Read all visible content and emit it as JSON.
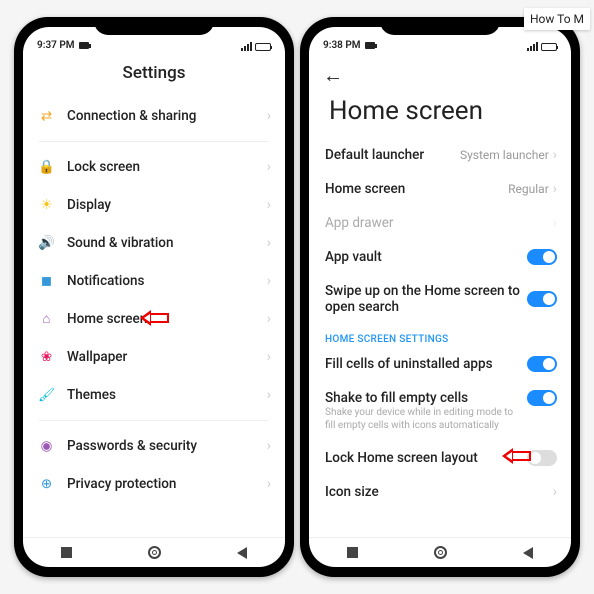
{
  "floating_label": "How To M",
  "left": {
    "status": {
      "time": "9:37 PM",
      "battery_pct": "70"
    },
    "title": "Settings",
    "groups": [
      [
        {
          "icon": "share-icon",
          "color": "ic-orange",
          "label": "Connection & sharing"
        }
      ],
      [
        {
          "icon": "lock-icon",
          "color": "ic-red",
          "label": "Lock screen"
        },
        {
          "icon": "sun-icon",
          "color": "ic-yellow",
          "label": "Display"
        },
        {
          "icon": "sound-icon",
          "color": "ic-green",
          "label": "Sound & vibration"
        },
        {
          "icon": "bell-icon",
          "color": "ic-blue",
          "label": "Notifications"
        },
        {
          "icon": "home-icon",
          "color": "ic-purple",
          "label": "Home screen",
          "callout": true
        },
        {
          "icon": "flower-icon",
          "color": "ic-pink",
          "label": "Wallpaper"
        },
        {
          "icon": "brush-icon",
          "color": "ic-cyan",
          "label": "Themes"
        }
      ],
      [
        {
          "icon": "shield-icon",
          "color": "ic-purple",
          "label": "Passwords & security"
        },
        {
          "icon": "privacy-icon",
          "color": "ic-blue",
          "label": "Privacy protection"
        }
      ]
    ]
  },
  "right": {
    "status": {
      "time": "9:38 PM",
      "battery_pct": "70"
    },
    "title": "Home screen",
    "rows": [
      {
        "type": "value",
        "label": "Default launcher",
        "value": "System launcher"
      },
      {
        "type": "value",
        "label": "Home screen",
        "value": "Regular"
      },
      {
        "type": "disabled",
        "label": "App drawer"
      },
      {
        "type": "toggle",
        "label": "App vault",
        "on": true
      },
      {
        "type": "toggle",
        "label": "Swipe up on the Home screen to open search",
        "on": true
      }
    ],
    "section_label": "HOME SCREEN SETTINGS",
    "rows2": [
      {
        "type": "toggle",
        "label": "Fill cells of uninstalled apps",
        "on": true
      },
      {
        "type": "toggle",
        "label": "Shake to fill empty cells",
        "sub": "Shake your device while in editing mode to fill empty cells with icons automatically",
        "on": true
      },
      {
        "type": "toggle",
        "label": "Lock Home screen layout",
        "on": false,
        "callout": true
      },
      {
        "type": "nav",
        "label": "Icon size"
      }
    ]
  }
}
